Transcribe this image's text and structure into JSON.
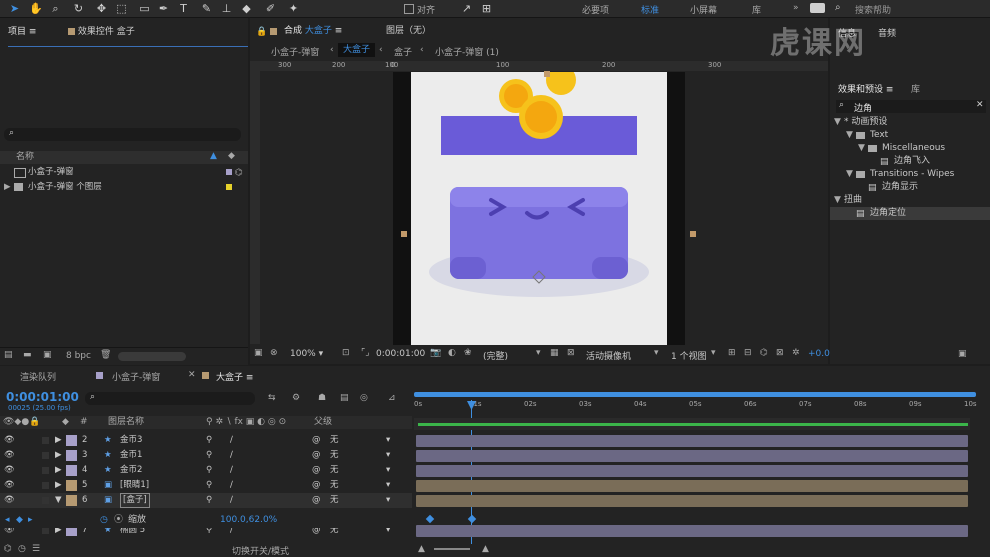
{
  "toolbar": {
    "align_label": "对齐",
    "workspaces": [
      "必要项",
      "标准",
      "小屏幕",
      "库"
    ],
    "active_workspace": "标准",
    "search_placeholder": "搜索帮助"
  },
  "project": {
    "tab_label": "项目",
    "effect_controls_label": "效果控件 盒子",
    "name_col": "名称",
    "items": [
      "小盒子-弹窗",
      "小盒子-弹窗 个图层"
    ],
    "bpc": "8 bpc"
  },
  "composition": {
    "tab_label": "合成",
    "comp_name": "大盒子",
    "layer_tab": "图层（无）",
    "breadcrumbs": [
      "小盒子-弹窗",
      "大盒子",
      "盒子",
      "小盒子-弹窗 (1)"
    ],
    "active_breadcrumb": "大盒子",
    "ruler_labels": [
      "300",
      "200",
      "100",
      "0",
      "100",
      "200",
      "300"
    ],
    "zoom": "100%",
    "timecode": "0:00:01:00",
    "resolution": "(完整)",
    "camera": "活动摄像机",
    "views": "1 个视图",
    "exposure": "+0.0"
  },
  "effects": {
    "info_label": "信息",
    "audio_label": "音频",
    "preview_label": "预览",
    "tab_label": "效果和预设",
    "lib_label": "库",
    "search_value": "边角",
    "tree": [
      {
        "label": "* 动画预设",
        "level": 0,
        "type": "folder-open"
      },
      {
        "label": "Text",
        "level": 1,
        "type": "folder-open"
      },
      {
        "label": "Miscellaneous",
        "level": 2,
        "type": "folder-open"
      },
      {
        "label": "边角飞入",
        "level": 3,
        "type": "preset"
      },
      {
        "label": "Transitions - Wipes",
        "level": 1,
        "type": "folder-open"
      },
      {
        "label": "边角显示",
        "level": 2,
        "type": "preset"
      },
      {
        "label": "扭曲",
        "level": 0,
        "type": "folder-open"
      },
      {
        "label": "边角定位",
        "level": 1,
        "type": "effect",
        "selected": true
      }
    ]
  },
  "timeline": {
    "tabs": [
      "渲染队列",
      "小盒子-弹窗",
      "大盒子"
    ],
    "active_tab": "大盒子",
    "timecode": "0:00:01:00",
    "frame_info": "00025 (25.00 fps)",
    "layer_name_col": "图层名称",
    "parent_col": "父级",
    "ruler_labels": [
      "0s",
      "01s",
      "02s",
      "03s",
      "04s",
      "05s",
      "06s",
      "07s",
      "08s",
      "09s",
      "10s"
    ],
    "layers": [
      {
        "num": "2",
        "name": "金币3",
        "type": "shape",
        "color": "#a7a0c9",
        "parent": "无"
      },
      {
        "num": "3",
        "name": "金币1",
        "type": "shape",
        "color": "#a7a0c9",
        "parent": "无"
      },
      {
        "num": "4",
        "name": "金币2",
        "type": "shape",
        "color": "#a7a0c9",
        "parent": "无"
      },
      {
        "num": "5",
        "name": "[眼睛1]",
        "type": "precomp",
        "color": "#b69a72",
        "parent": "无"
      },
      {
        "num": "6",
        "name": "[盒子]",
        "type": "precomp",
        "color": "#b69a72",
        "parent": "无",
        "selected": true
      },
      {
        "num": "7",
        "name": "椭圆 5",
        "type": "shape",
        "color": "#a7a0c9",
        "parent": "无"
      }
    ],
    "property_name": "缩放",
    "property_value": "100.0,62.0%",
    "footer_label": "切换开关/模式"
  },
  "watermark": "虎课网",
  "colors": {
    "accent": "#2d8ceb",
    "box_purple": "#7d72e0",
    "lid_purple": "#6a5bd8",
    "coin_gold": "#f6c21b"
  }
}
